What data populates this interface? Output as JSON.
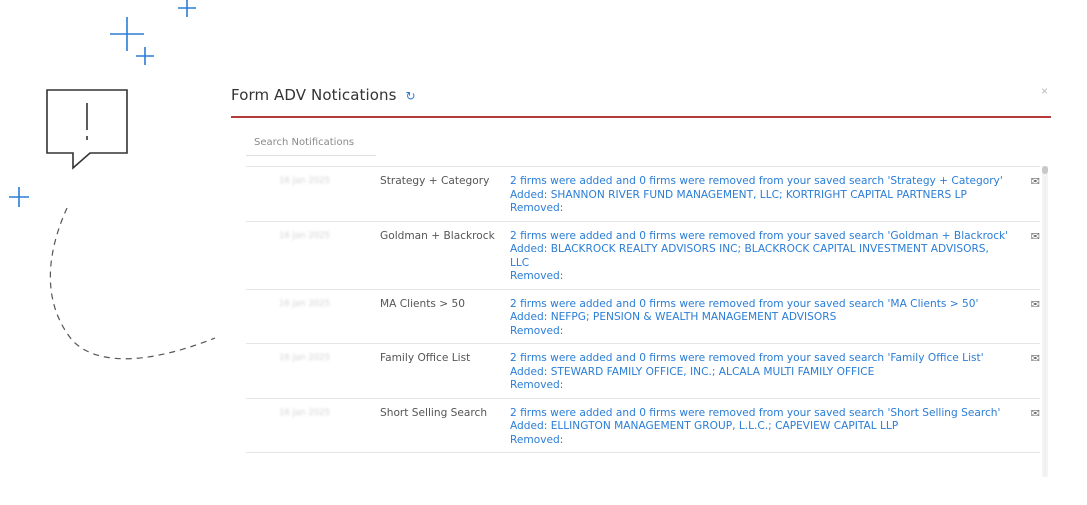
{
  "modal": {
    "title": "Form ADV Notications",
    "refresh_icon": "↻",
    "close_icon": "×",
    "accent_color": "#b53a3a",
    "link_color": "#2a7dd6"
  },
  "search": {
    "placeholder": "Search Notifications",
    "value": ""
  },
  "notifications": [
    {
      "date": "16 Jan 2025",
      "search_name": "Strategy + Category",
      "summary": "2 firms were added and 0 firms were removed from your saved search 'Strategy + Category'",
      "added": "Added: SHANNON RIVER FUND MANAGEMENT, LLC; KORTRIGHT CAPITAL PARTNERS LP",
      "removed": "Removed:",
      "icon": "envelope-icon"
    },
    {
      "date": "16 Jan 2025",
      "search_name": "Goldman + Blackrock",
      "summary": "2 firms were added and 0 firms were removed from your saved search 'Goldman + Blackrock'",
      "added": "Added: BLACKROCK REALTY ADVISORS INC; BLACKROCK CAPITAL INVESTMENT ADVISORS, LLC",
      "removed": "Removed:",
      "icon": "envelope-icon"
    },
    {
      "date": "16 Jan 2025",
      "search_name": "MA Clients > 50",
      "summary": "2 firms were added and 0 firms were removed from your saved search 'MA Clients > 50'",
      "added": "Added: NEFPG; PENSION & WEALTH MANAGEMENT ADVISORS",
      "removed": "Removed:",
      "icon": "envelope-icon"
    },
    {
      "date": "16 Jan 2025",
      "search_name": "Family Office List",
      "summary": "2 firms were added and 0 firms were removed from your saved search 'Family Office List'",
      "added": "Added: STEWARD FAMILY OFFICE, INC.; ALCALA MULTI FAMILY OFFICE",
      "removed": "Removed:",
      "icon": "envelope-icon"
    },
    {
      "date": "16 Jan 2025",
      "search_name": "Short Selling Search",
      "summary": "2 firms were added and 0 firms were removed from your saved search 'Short Selling Search'",
      "added": "Added: ELLINGTON MANAGEMENT GROUP, L.L.C.; CAPEVIEW CAPITAL LLP",
      "removed": "Removed:",
      "icon": "envelope-icon"
    }
  ]
}
